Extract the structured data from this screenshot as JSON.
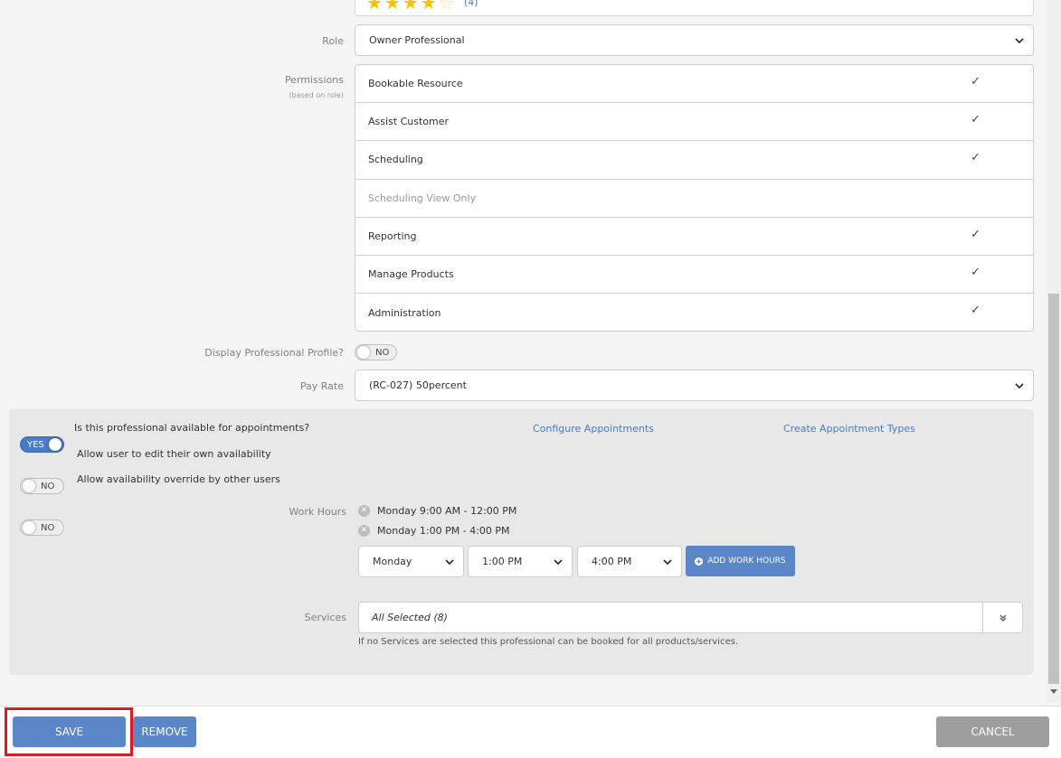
{
  "rating": {
    "stars": "★★★★",
    "empty_star": "☆",
    "count": "(4)"
  },
  "role": {
    "label": "Role",
    "value": "Owner Professional"
  },
  "permissions": {
    "label": "Permissions",
    "sublabel": "(based on role)",
    "check_glyph": "✓",
    "items": [
      {
        "label": "Bookable Resource",
        "checked": true
      },
      {
        "label": "Assist Customer",
        "checked": true
      },
      {
        "label": "Scheduling",
        "checked": true
      },
      {
        "label": "Scheduling View Only",
        "checked": false
      },
      {
        "label": "Reporting",
        "checked": true
      },
      {
        "label": "Manage Products",
        "checked": true
      },
      {
        "label": "Administration",
        "checked": true
      }
    ]
  },
  "display_profile": {
    "label": "Display Professional Profile?",
    "toggle": "NO"
  },
  "pay_rate": {
    "label": "Pay Rate",
    "value": "(RC-027) 50percent"
  },
  "availability": {
    "available_toggle": "YES",
    "available_label": "Is this professional available for appointments?",
    "configure_link": "Configure Appointments",
    "create_types_link": "Create Appointment Types",
    "edit_own_toggle": "NO",
    "edit_own_label": "Allow user to edit their own availability",
    "override_toggle": "NO",
    "override_label": "Allow availability override by other users"
  },
  "work_hours": {
    "label": "Work Hours",
    "entries": [
      "Monday 9:00 AM - 12:00 PM",
      "Monday 1:00 PM - 4:00 PM"
    ],
    "day": "Monday",
    "start": "1:00 PM",
    "end": "4:00 PM",
    "add_button": "ADD WORK HOURS"
  },
  "services": {
    "label": "Services",
    "value": "All Selected (8)",
    "hint": "If no Services are selected this professional can be booked for all products/services."
  },
  "footer": {
    "save": "SAVE",
    "remove": "REMOVE",
    "cancel": "CANCEL"
  },
  "colors": {
    "accent": "#5b87c8",
    "highlight": "#e0191e",
    "star": "#f4c20d"
  }
}
